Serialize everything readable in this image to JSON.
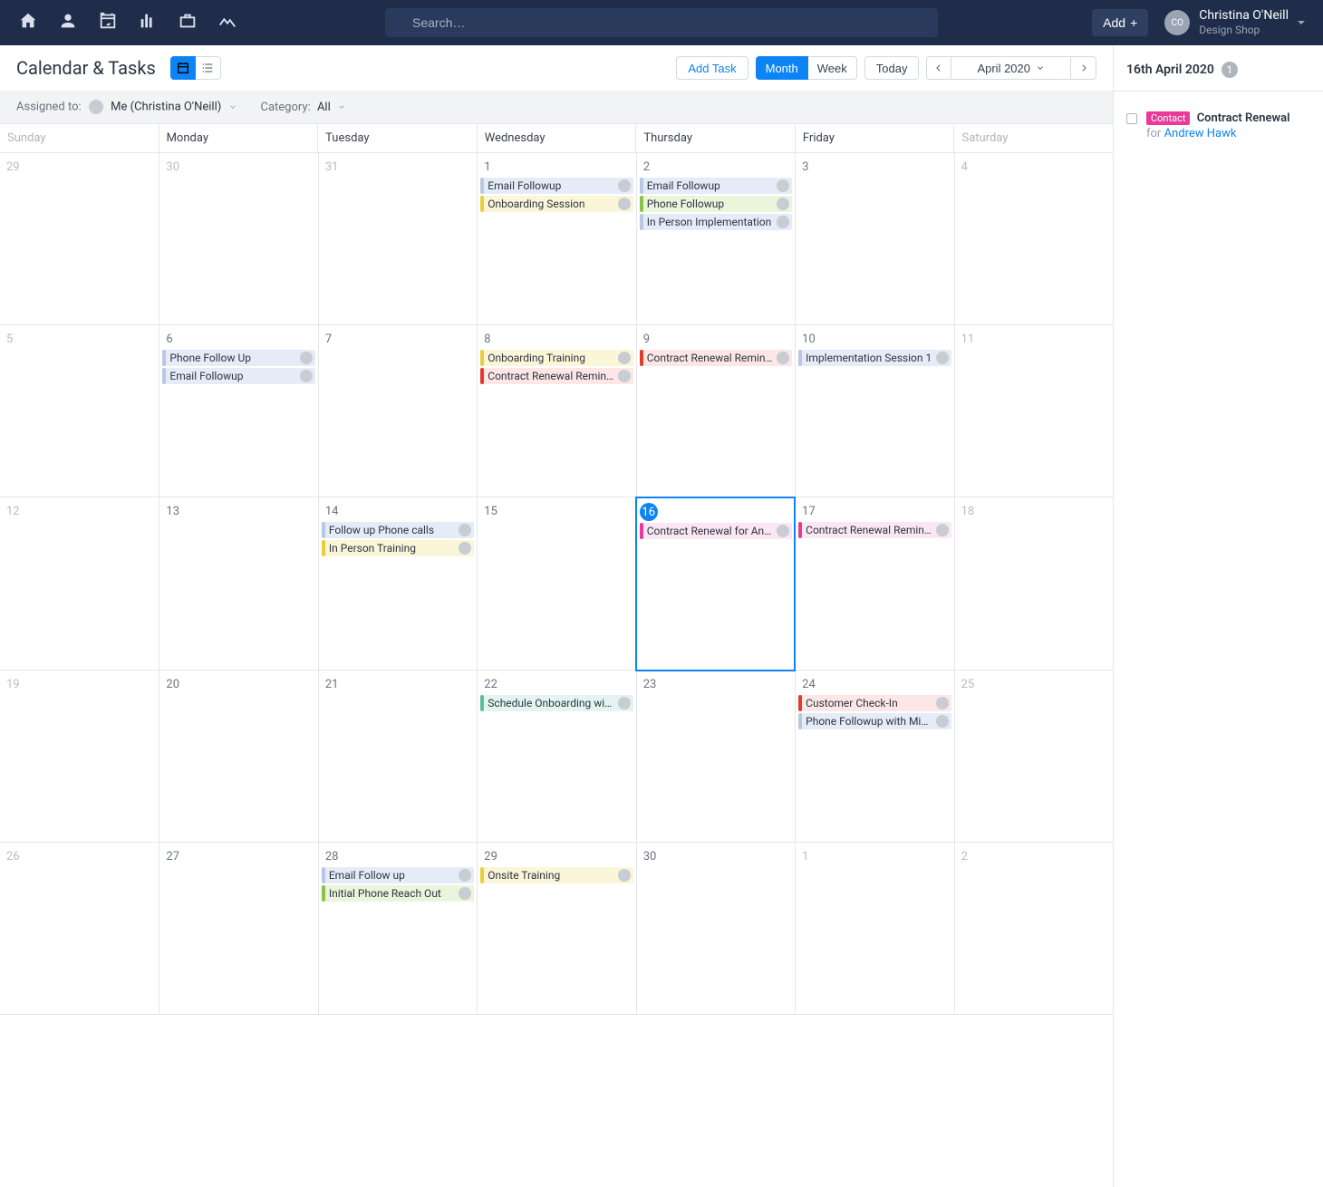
{
  "topbar": {
    "search_placeholder": "Search…",
    "add_label": "Add",
    "user_name": "Christina O'Neill",
    "user_company": "Design Shop",
    "avatar_initials": "CO"
  },
  "header": {
    "title": "Calendar & Tasks",
    "add_task": "Add Task",
    "view_month": "Month",
    "view_week": "Week",
    "today": "Today",
    "month_label": "April 2020"
  },
  "filter": {
    "assigned_label": "Assigned to:",
    "assigned_value": "Me (Christina O'Neill)",
    "category_label": "Category:",
    "category_value": "All"
  },
  "weekdays": [
    "Sunday",
    "Monday",
    "Tuesday",
    "Wednesday",
    "Thursday",
    "Friday",
    "Saturday"
  ],
  "days": [
    {
      "n": "29",
      "muted": true
    },
    {
      "n": "30",
      "muted": true
    },
    {
      "n": "31",
      "muted": true
    },
    {
      "n": "1",
      "tasks": [
        {
          "c": "blue",
          "t": "Email Followup"
        },
        {
          "c": "yellow",
          "t": "Onboarding Session"
        }
      ]
    },
    {
      "n": "2",
      "tasks": [
        {
          "c": "blue",
          "t": "Email Followup"
        },
        {
          "c": "green",
          "t": "Phone Followup"
        },
        {
          "c": "blue",
          "t": "In Person Implementation"
        }
      ]
    },
    {
      "n": "3"
    },
    {
      "n": "4",
      "muted": true
    },
    {
      "n": "5",
      "muted": true
    },
    {
      "n": "6",
      "tasks": [
        {
          "c": "blue",
          "t": "Phone Follow Up"
        },
        {
          "c": "blue",
          "t": "Email Followup"
        }
      ]
    },
    {
      "n": "7"
    },
    {
      "n": "8",
      "tasks": [
        {
          "c": "yellow",
          "t": "Onboarding Training"
        },
        {
          "c": "red",
          "t": "Contract Renewal Reminder"
        }
      ]
    },
    {
      "n": "9",
      "tasks": [
        {
          "c": "red",
          "t": "Contract Renewal Reminder"
        }
      ]
    },
    {
      "n": "10",
      "tasks": [
        {
          "c": "blue",
          "t": "Implementation Session 1"
        }
      ]
    },
    {
      "n": "11",
      "muted": true
    },
    {
      "n": "12",
      "muted": true
    },
    {
      "n": "13"
    },
    {
      "n": "14",
      "tasks": [
        {
          "c": "blue",
          "t": "Follow up Phone calls"
        },
        {
          "c": "yellow",
          "t": "In Person Training"
        }
      ]
    },
    {
      "n": "15"
    },
    {
      "n": "16",
      "today": true,
      "selected": true,
      "tasks": [
        {
          "c": "pink",
          "t": "Contract Renewal for Andr…"
        }
      ]
    },
    {
      "n": "17",
      "tasks": [
        {
          "c": "pink",
          "t": "Contract Renewal Reminder"
        }
      ]
    },
    {
      "n": "18",
      "muted": true
    },
    {
      "n": "19",
      "muted": true
    },
    {
      "n": "20"
    },
    {
      "n": "21"
    },
    {
      "n": "22",
      "tasks": [
        {
          "c": "aqua",
          "t": "Schedule Onboarding with…"
        }
      ]
    },
    {
      "n": "23"
    },
    {
      "n": "24",
      "tasks": [
        {
          "c": "red",
          "t": "Customer Check-In"
        },
        {
          "c": "blue",
          "t": "Phone Followup with Mike"
        }
      ]
    },
    {
      "n": "25",
      "muted": true
    },
    {
      "n": "26",
      "muted": true
    },
    {
      "n": "27"
    },
    {
      "n": "28",
      "tasks": [
        {
          "c": "blue",
          "t": "Email Follow up"
        },
        {
          "c": "green",
          "t": "Initial Phone Reach Out"
        }
      ]
    },
    {
      "n": "29",
      "tasks": [
        {
          "c": "yellow",
          "t": "Onsite Training"
        }
      ]
    },
    {
      "n": "30"
    },
    {
      "n": "1",
      "muted": true
    },
    {
      "n": "2",
      "muted": true
    }
  ],
  "sidebar": {
    "date": "16th April 2020",
    "count": "1",
    "tag": "Contact",
    "task_title": "Contract Renewal",
    "for": "for",
    "link": "Andrew Hawk"
  }
}
